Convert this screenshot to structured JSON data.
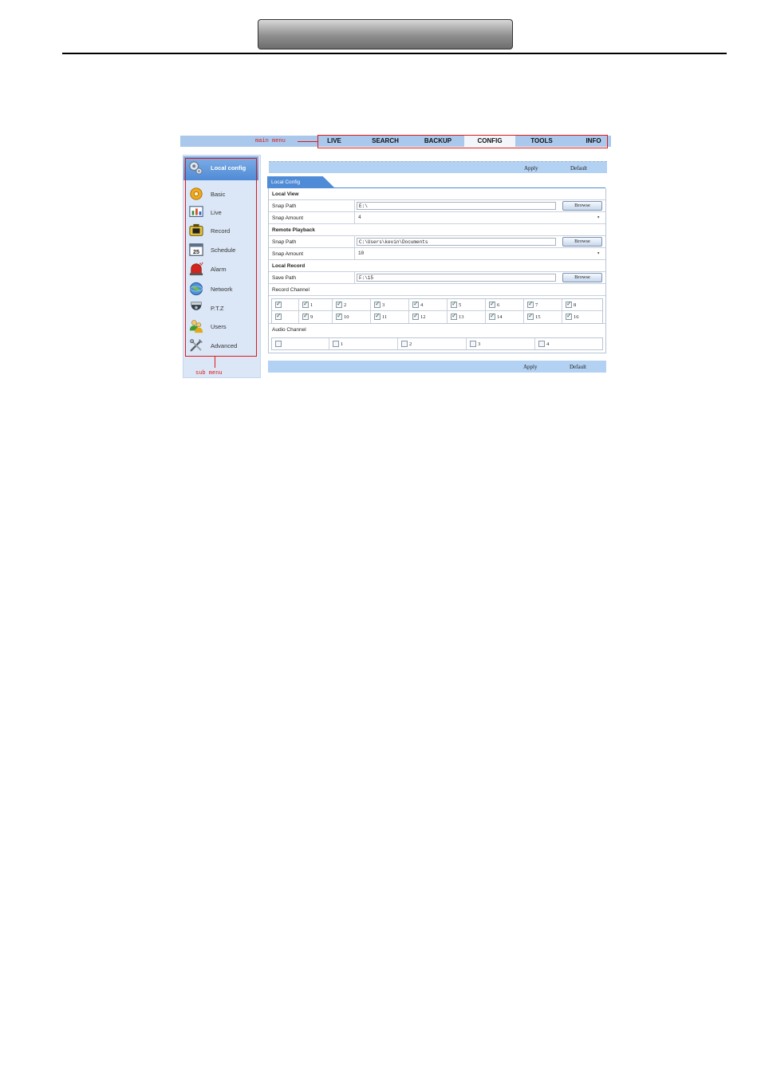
{
  "main_menu": {
    "annotation": "main menu",
    "items": [
      {
        "label": "LIVE",
        "active": false
      },
      {
        "label": "SEARCH",
        "active": false
      },
      {
        "label": "BACKUP",
        "active": false
      },
      {
        "label": "CONFIG",
        "active": true
      },
      {
        "label": "TOOLS",
        "active": false
      },
      {
        "label": "INFO",
        "active": false
      }
    ]
  },
  "sub_menu": {
    "annotation": "sub menu",
    "header": {
      "label": "Local config",
      "icon": "gear-pair-icon"
    },
    "items": [
      {
        "label": "Basic",
        "icon": "gear-icon"
      },
      {
        "label": "Live",
        "icon": "chart-monitor-icon"
      },
      {
        "label": "Record",
        "icon": "film-camera-icon"
      },
      {
        "label": "Schedule",
        "icon": "calendar-icon"
      },
      {
        "label": "Alarm",
        "icon": "alarm-siren-icon"
      },
      {
        "label": "Network",
        "icon": "globe-icon"
      },
      {
        "label": "P.T.Z",
        "icon": "dome-camera-icon"
      },
      {
        "label": "Users",
        "icon": "users-icon"
      },
      {
        "label": "Advanced",
        "icon": "tools-icon"
      }
    ]
  },
  "toolbar": {
    "apply": "Apply",
    "default": "Default"
  },
  "tab": {
    "label": "Local Config"
  },
  "local_view": {
    "section": "Local View",
    "snap_path_label": "Snap Path",
    "snap_path_value": "E:\\",
    "snap_amount_label": "Snap Amount",
    "snap_amount_value": "4"
  },
  "remote_playback": {
    "section": "Remote Playback",
    "snap_path_label": "Snap Path",
    "snap_path_value": "C:\\Users\\kevin\\Documents",
    "snap_amount_label": "Snap Amount",
    "snap_amount_value": "10"
  },
  "local_record": {
    "section": "Local Record",
    "save_path_label": "Save Path",
    "save_path_value": "F:\\15",
    "record_channel_label": "Record Channel",
    "audio_channel_label": "Audio Channel"
  },
  "browse_label": "Browse",
  "record_channels": {
    "row1": [
      {
        "num": "",
        "checked": true
      },
      {
        "num": "1",
        "checked": true
      },
      {
        "num": "2",
        "checked": true
      },
      {
        "num": "3",
        "checked": true
      },
      {
        "num": "4",
        "checked": true
      },
      {
        "num": "5",
        "checked": true
      },
      {
        "num": "6",
        "checked": true
      },
      {
        "num": "7",
        "checked": true
      },
      {
        "num": "8",
        "checked": true
      }
    ],
    "row2": [
      {
        "num": "",
        "checked": true
      },
      {
        "num": "9",
        "checked": true
      },
      {
        "num": "10",
        "checked": true
      },
      {
        "num": "11",
        "checked": true
      },
      {
        "num": "12",
        "checked": true
      },
      {
        "num": "13",
        "checked": true
      },
      {
        "num": "14",
        "checked": true
      },
      {
        "num": "15",
        "checked": true
      },
      {
        "num": "16",
        "checked": true
      }
    ]
  },
  "audio_channels": [
    {
      "num": "",
      "checked": false
    },
    {
      "num": "1",
      "checked": false
    },
    {
      "num": "2",
      "checked": false
    },
    {
      "num": "3",
      "checked": false
    },
    {
      "num": "4",
      "checked": false
    }
  ]
}
